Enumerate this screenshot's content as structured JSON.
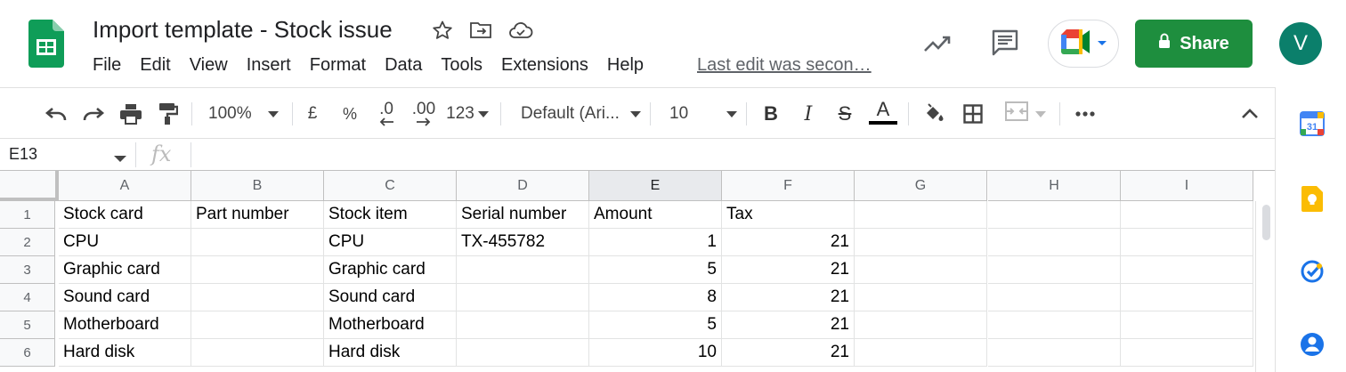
{
  "header": {
    "title": "Import template - Stock issue",
    "menu": [
      "File",
      "Edit",
      "View",
      "Insert",
      "Format",
      "Data",
      "Tools",
      "Extensions",
      "Help"
    ],
    "last_edit": "Last edit was secon…",
    "share_label": "Share",
    "avatar_letter": "V",
    "icons": [
      "sheets-logo-icon",
      "star-icon",
      "move-folder-icon",
      "cloud-saved-icon",
      "activity-trend-icon",
      "comments-icon",
      "meet-icon",
      "lock-icon",
      "chevron-down-icon"
    ]
  },
  "toolbar": {
    "zoom": "100%",
    "currency": "£",
    "percent": "%",
    "decrease_decimals": ".0",
    "increase_decimals": ".00",
    "more_formats": "123",
    "font": "Default (Ari...",
    "font_size": "10",
    "bold": "B",
    "italic": "I",
    "strikethrough": "S",
    "text_color": "A",
    "text_color_value": "#000000"
  },
  "formula_bar": {
    "name_box": "E13",
    "fx": "fx",
    "formula": ""
  },
  "sheet": {
    "columns": [
      "A",
      "B",
      "C",
      "D",
      "E",
      "F",
      "G",
      "H",
      "I"
    ],
    "selected_column": "E",
    "rows": [
      {
        "num": "1",
        "cells": [
          "Stock card",
          "Part number",
          "Stock item",
          "Serial number",
          "Amount",
          "Tax",
          "",
          "",
          ""
        ]
      },
      {
        "num": "2",
        "cells": [
          "CPU",
          "",
          "CPU",
          "TX-455782",
          "1",
          "21",
          "",
          "",
          ""
        ]
      },
      {
        "num": "3",
        "cells": [
          "Graphic card",
          "",
          "Graphic card",
          "",
          "5",
          "21",
          "",
          "",
          ""
        ]
      },
      {
        "num": "4",
        "cells": [
          "Sound card",
          "",
          "Sound card",
          "",
          "8",
          "21",
          "",
          "",
          ""
        ]
      },
      {
        "num": "5",
        "cells": [
          "Motherboard",
          "",
          "Motherboard",
          "",
          "5",
          "21",
          "",
          "",
          ""
        ]
      },
      {
        "num": "6",
        "cells": [
          "Hard disk",
          "",
          "Hard disk",
          "",
          "10",
          "21",
          "",
          "",
          ""
        ]
      }
    ]
  },
  "side_panel": {
    "calendar_day": "31",
    "icons": [
      "calendar-icon",
      "keep-icon",
      "tasks-icon",
      "contacts-icon"
    ]
  },
  "colors": {
    "share": "#1e8e3e",
    "avatar": "#0b7f6b",
    "sheets_green": "#0f9d58"
  }
}
